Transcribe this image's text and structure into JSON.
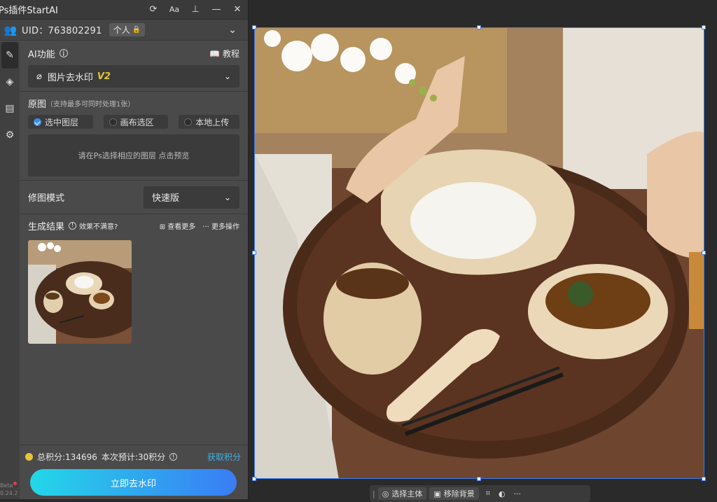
{
  "title": "Ps插件StartAI",
  "titlebar_icons": [
    "refresh-icon",
    "font-size-icon",
    "pin-icon",
    "minimize-icon",
    "close-icon"
  ],
  "uid_label": "UID：763802291",
  "account_badge": "个人",
  "ai_feature": {
    "label": "AI功能",
    "tutorial": "教程",
    "selected": "图片去水印",
    "version": "V2"
  },
  "source": {
    "label": "原图",
    "note": "（支持最多可同时处理1张）",
    "options": [
      "选中图层",
      "画布选区",
      "本地上传"
    ],
    "selected_index": 0,
    "preview_hint": "请在Ps选择相应的图层 点击预览"
  },
  "mode": {
    "label": "修图模式",
    "value": "快速版"
  },
  "result": {
    "label": "生成结果",
    "unsatisfied": "效果不满意?",
    "view_more": "查看更多",
    "more_actions": "更多操作"
  },
  "credits": {
    "total": "总积分:134696",
    "estimate": "本次预计:30积分",
    "get": "获取积分"
  },
  "action_button": "立即去水印",
  "version": {
    "beta": "Beta",
    "number": "0.24.2"
  },
  "canvas_toolbar": {
    "select_subject": "选择主体",
    "remove_bg": "移除背景"
  },
  "colors": {
    "accent": "#3a8ee6",
    "gradient_start": "#23d7e8",
    "gradient_end": "#3a7cf5",
    "link": "#3fb3e8"
  }
}
